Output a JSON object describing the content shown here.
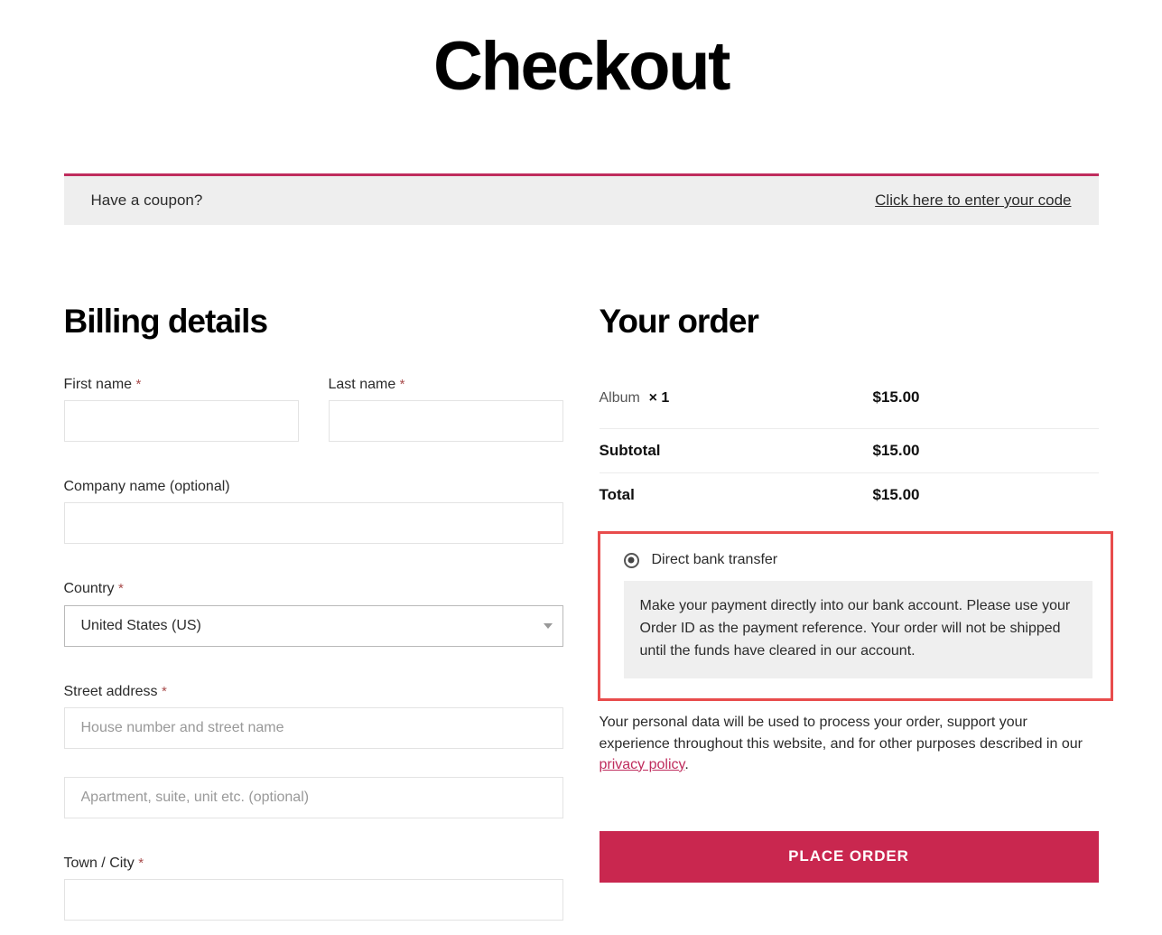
{
  "page": {
    "title": "Checkout"
  },
  "coupon": {
    "prompt": "Have a coupon?",
    "link_label": "Click here to enter your code",
    "accent_color": "#bf2c5d"
  },
  "billing": {
    "heading": "Billing details",
    "required_marker": "*",
    "fields": {
      "first_name": {
        "label": "First name",
        "required": true,
        "value": "",
        "placeholder": ""
      },
      "last_name": {
        "label": "Last name",
        "required": true,
        "value": "",
        "placeholder": ""
      },
      "company_name": {
        "label": "Company name (optional)",
        "required": false,
        "value": "",
        "placeholder": ""
      },
      "country": {
        "label": "Country",
        "required": true,
        "value": "United States (US)"
      },
      "street_address": {
        "label": "Street address",
        "required": true,
        "value": "",
        "placeholder": "House number and street name"
      },
      "address_line_2": {
        "label": "",
        "required": false,
        "value": "",
        "placeholder": "Apartment, suite, unit etc. (optional)"
      },
      "town_city": {
        "label": "Town / City",
        "required": true,
        "value": "",
        "placeholder": ""
      }
    }
  },
  "order": {
    "heading": "Your order",
    "line_items": [
      {
        "name": "Album",
        "quantity_label": "× 1",
        "amount": "$15.00"
      }
    ],
    "subtotal_label": "Subtotal",
    "subtotal_amount": "$15.00",
    "total_label": "Total",
    "total_amount": "$15.00"
  },
  "payment": {
    "highlight_color": "#e84c4c",
    "selected_method": "Direct bank transfer",
    "description": "Make your payment directly into our bank account. Please use your Order ID as the payment reference. Your order will not be shipped until the funds have cleared in our account.",
    "privacy_text_before": "Your personal data will be used to process your order, support your experience throughout this website, and for other purposes described in our ",
    "privacy_link_label": "privacy policy",
    "privacy_text_after": ".",
    "place_order_label": "Place order",
    "button_color": "#c9274f"
  }
}
